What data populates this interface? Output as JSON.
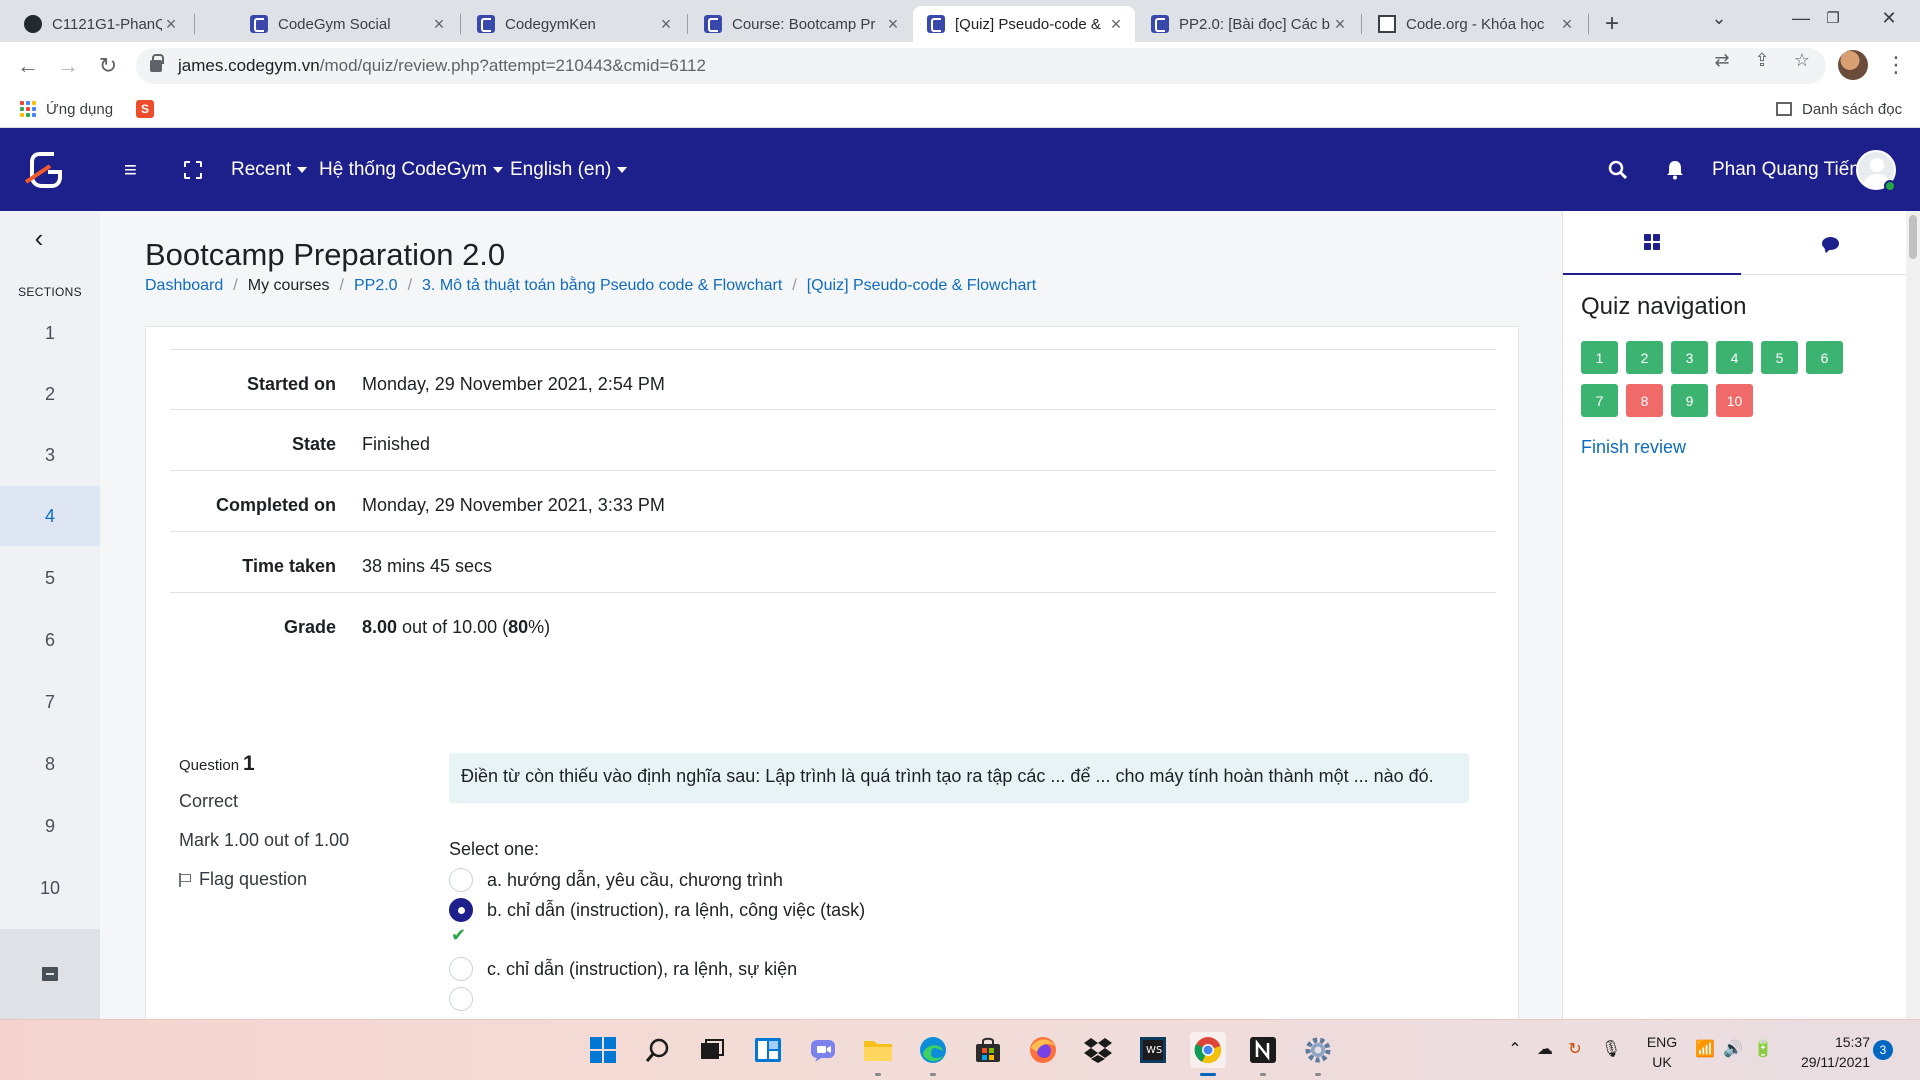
{
  "browser": {
    "tabs": [
      {
        "title": "C1121G1-PhanQuang",
        "favicon": "github-icon",
        "active": false
      },
      {
        "title": "CodeGym Social",
        "favicon": "codegym-icon",
        "active": false
      },
      {
        "title": "CodegymKen",
        "favicon": "codegym-icon",
        "active": false
      },
      {
        "title": "Course: Bootcamp Pr",
        "favicon": "codegym-icon",
        "active": false
      },
      {
        "title": "[Quiz] Pseudo-code &",
        "favicon": "codegym-icon",
        "active": true
      },
      {
        "title": "PP2.0: [Bài đọc] Các b",
        "favicon": "codegym-icon",
        "active": false
      },
      {
        "title": "Code.org - Khóa học",
        "favicon": "codeorg-icon",
        "active": false
      }
    ],
    "new_tab": "+",
    "url_host": "james.codegym.vn",
    "url_path": "/mod/quiz/review.php?attempt=210443&cmid=6112",
    "bookmarks": {
      "apps": "Ứng dụng",
      "reading_list": "Danh sách đọc"
    }
  },
  "navbar": {
    "menu": [
      {
        "label": "Recent"
      },
      {
        "label": "Hệ thống CodeGym"
      },
      {
        "label": "English (en)"
      }
    ],
    "user_name": "Phan Quang Tiến"
  },
  "left_drawer": {
    "label": "SECTIONS",
    "sections": [
      "1",
      "2",
      "3",
      "4",
      "5",
      "6",
      "7",
      "8",
      "9",
      "10"
    ],
    "active_section": "4"
  },
  "page": {
    "title": "Bootcamp Preparation 2.0",
    "breadcrumb": [
      {
        "label": "Dashboard",
        "link": true
      },
      {
        "label": "My courses",
        "link": false
      },
      {
        "label": "PP2.0",
        "link": true
      },
      {
        "label": "3. Mô tả thuật toán bằng Pseudo code & Flowchart",
        "link": true
      },
      {
        "label": "[Quiz] Pseudo-code & Flowchart",
        "link": true
      }
    ]
  },
  "summary": {
    "started_label": "Started on",
    "started_value": "Monday, 29 November 2021, 2:54 PM",
    "state_label": "State",
    "state_value": "Finished",
    "completed_label": "Completed on",
    "completed_value": "Monday, 29 November 2021, 3:33 PM",
    "time_label": "Time taken",
    "time_value": "38 mins 45 secs",
    "grade_label": "Grade",
    "grade_score": "8.00",
    "grade_mid": " out of 10.00 (",
    "grade_percent": "80",
    "grade_end": "%)"
  },
  "question": {
    "number_label": "Question",
    "number": "1",
    "status": "Correct",
    "mark": "Mark 1.00 out of 1.00",
    "flag_label": "Flag question",
    "text": "Điền từ còn thiếu vào định nghĩa sau: Lập trình là quá trình tạo ra tập các ... để ... cho máy tính hoàn thành một ... nào đó.",
    "select_prompt": "Select one:",
    "answers": [
      {
        "label": "a. hướng dẫn, yêu cầu, chương trình",
        "selected": false
      },
      {
        "label": "b. chỉ dẫn (instruction), ra lệnh, công việc (task)",
        "selected": true
      },
      {
        "label": "c. chỉ dẫn (instruction), ra lệnh, sự kiện",
        "selected": false
      }
    ],
    "correct_mark": "✔"
  },
  "quiz_nav": {
    "title": "Quiz navigation",
    "items": [
      {
        "n": "1",
        "state": "correct"
      },
      {
        "n": "2",
        "state": "correct"
      },
      {
        "n": "3",
        "state": "correct"
      },
      {
        "n": "4",
        "state": "correct"
      },
      {
        "n": "5",
        "state": "correct"
      },
      {
        "n": "6",
        "state": "correct"
      },
      {
        "n": "7",
        "state": "correct"
      },
      {
        "n": "8",
        "state": "incorrect"
      },
      {
        "n": "9",
        "state": "correct"
      },
      {
        "n": "10",
        "state": "incorrect"
      }
    ],
    "finish_label": "Finish review"
  },
  "colors": {
    "navbar": "#1d1f8a",
    "link": "#0f6cbf",
    "correct": "#3cb371",
    "incorrect": "#f06a6a"
  },
  "taskbar": {
    "lang_top": "ENG",
    "lang_bottom": "UK",
    "time": "15:37",
    "date": "29/11/2021",
    "notifications": "3"
  }
}
